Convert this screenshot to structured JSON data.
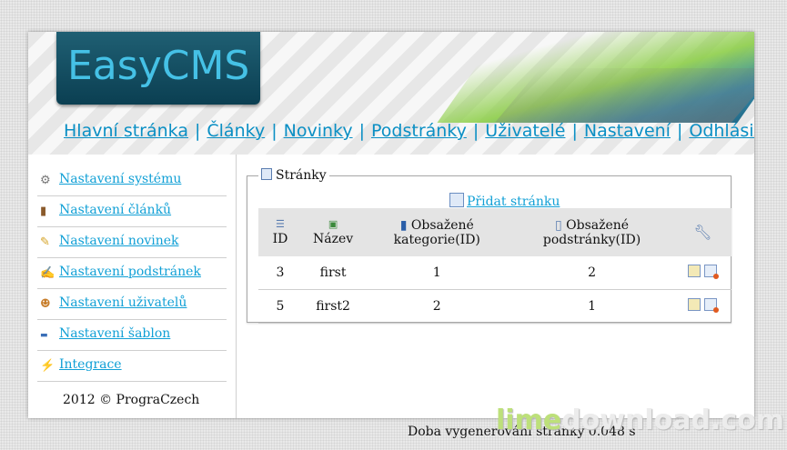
{
  "app": {
    "logo": "EasyCMS"
  },
  "nav": [
    {
      "label": "Hlavní stránka"
    },
    {
      "label": "Články"
    },
    {
      "label": "Novinky"
    },
    {
      "label": "Podstránky"
    },
    {
      "label": "Uživatelé"
    },
    {
      "label": "Nastavení"
    },
    {
      "label": "Odhlásit se"
    }
  ],
  "nav_separator": "|",
  "sidebar": {
    "items": [
      {
        "label": " Nastavení systému",
        "icon": "gear-icon"
      },
      {
        "label": " Nastavení článků",
        "icon": "book-icon"
      },
      {
        "label": " Nastavení novinek",
        "icon": "pencil-icon"
      },
      {
        "label": " Nastavení podstránek",
        "icon": "edit-page-icon"
      },
      {
        "label": " Nastavení uživatelů",
        "icon": "users-icon"
      },
      {
        "label": " Nastavení šablon",
        "icon": "html-icon"
      },
      {
        "label": " Integrace",
        "icon": "magic-wand-icon"
      }
    ],
    "footer": "2012 © PrograCzech"
  },
  "main": {
    "legend": "Stránky",
    "add_link": "Přidat stránku",
    "table": {
      "headers": {
        "id": "ID",
        "name": "Název",
        "category": "Obsažené kategorie(ID)",
        "subpage": "Obsažené podstránky(ID)"
      },
      "rows": [
        {
          "id": "3",
          "name": "first",
          "category": "1",
          "subpage": "2"
        },
        {
          "id": "5",
          "name": "first2",
          "category": "2",
          "subpage": "1"
        }
      ]
    },
    "footer": "Doba vygenerování stránky 0.048 s"
  },
  "watermark": {
    "part1": "lime",
    "part2": "download.com"
  }
}
